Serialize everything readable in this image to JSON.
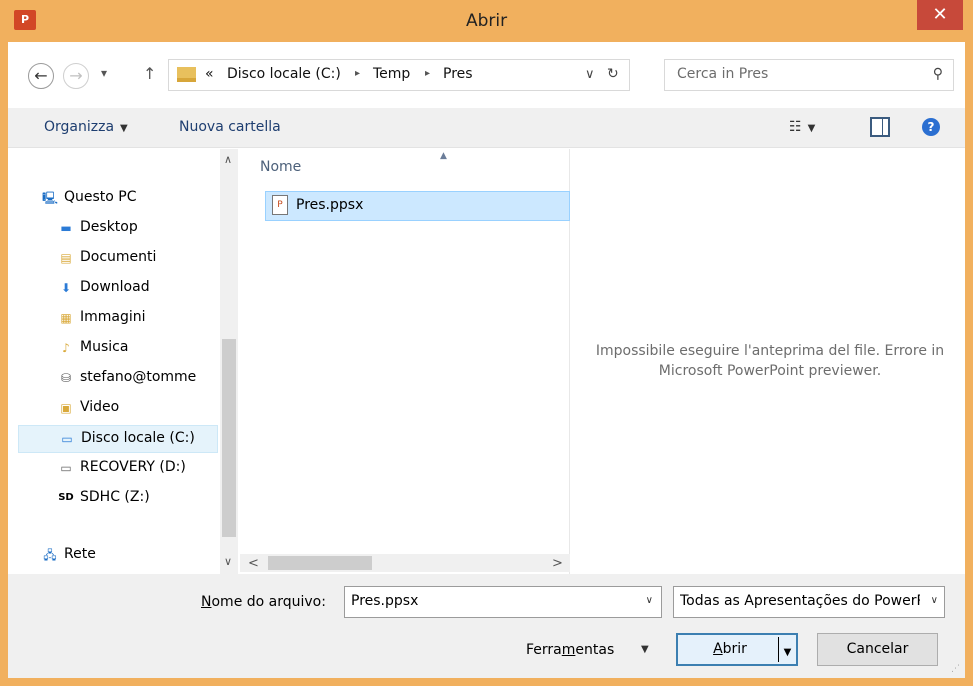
{
  "window": {
    "title": "Abrir",
    "app_icon": "P",
    "close_glyph": "✕"
  },
  "address": {
    "back_glyph": "←",
    "forward_glyph": "→",
    "recent_glyph": "▾",
    "up_glyph": "↑",
    "overflow": "«",
    "crumbs": [
      "Disco locale (C:)",
      "Temp",
      "Pres"
    ],
    "separator": "▸",
    "dropdown_glyph": "∨",
    "refresh_glyph": "↻"
  },
  "search": {
    "placeholder": "Cerca in Pres",
    "icon_glyph": "⚲"
  },
  "toolbar": {
    "organize_label": "Organizza",
    "new_folder_label": "Nuova cartella",
    "view_glyph": "☷",
    "pane_glyph": "□",
    "help_glyph": "?"
  },
  "nav": {
    "items": [
      {
        "label": "Questo PC",
        "icon": "computer-icon",
        "glyph": "🖳",
        "color": "#1a6cc4"
      },
      {
        "label": "Desktop",
        "icon": "desktop-folder-icon",
        "glyph": "▬",
        "color": "#2b7bd6"
      },
      {
        "label": "Documenti",
        "icon": "documents-folder-icon",
        "glyph": "▤",
        "color": "#d9a93a"
      },
      {
        "label": "Download",
        "icon": "downloads-folder-icon",
        "glyph": "⬇",
        "color": "#2b7bd6"
      },
      {
        "label": "Immagini",
        "icon": "pictures-folder-icon",
        "glyph": "▦",
        "color": "#d9a93a"
      },
      {
        "label": "Musica",
        "icon": "music-folder-icon",
        "glyph": "♪",
        "color": "#d9a93a"
      },
      {
        "label": "stefano@tomme",
        "icon": "network-drive-icon",
        "glyph": "⛁",
        "color": "#555"
      },
      {
        "label": "Video",
        "icon": "videos-folder-icon",
        "glyph": "▣",
        "color": "#d9a93a"
      },
      {
        "label": "Disco locale (C:)",
        "icon": "local-disk-icon",
        "glyph": "▭",
        "color": "#2b7bd6"
      },
      {
        "label": "RECOVERY (D:)",
        "icon": "drive-icon",
        "glyph": "▭",
        "color": "#666"
      },
      {
        "label": "SDHC (Z:)",
        "icon": "sd-card-icon",
        "glyph": "SD",
        "color": "#000"
      },
      {
        "label": "Rete",
        "icon": "network-icon",
        "glyph": "🖧",
        "color": "#1a6cc4"
      }
    ],
    "selected_index": 8,
    "scroll_up_glyph": "∧",
    "scroll_down_glyph": "∨"
  },
  "files": {
    "column_header": "Nome",
    "sort_glyph": "▲",
    "items": [
      {
        "name": "Pres.ppsx"
      }
    ],
    "scroll_left_glyph": "<",
    "scroll_right_glyph": ">"
  },
  "preview": {
    "message_line1": "Impossibile eseguire l'anteprima del file. Errore in",
    "message_line2": "Microsoft PowerPoint previewer."
  },
  "footer": {
    "filename_label_underlined": "N",
    "filename_label_rest": "ome do arquivo:",
    "filename_value": "Pres.ppsx",
    "filetype_value": "Todas as Apresentações do PowerPoint",
    "tools_label_pre": "Ferra",
    "tools_label_underlined": "m",
    "tools_label_post": "entas",
    "open_label_underlined": "A",
    "open_label_rest": "brir",
    "cancel_label": "Cancelar",
    "dropdown_glyph": "∨",
    "arrow_down_glyph": "▼"
  }
}
